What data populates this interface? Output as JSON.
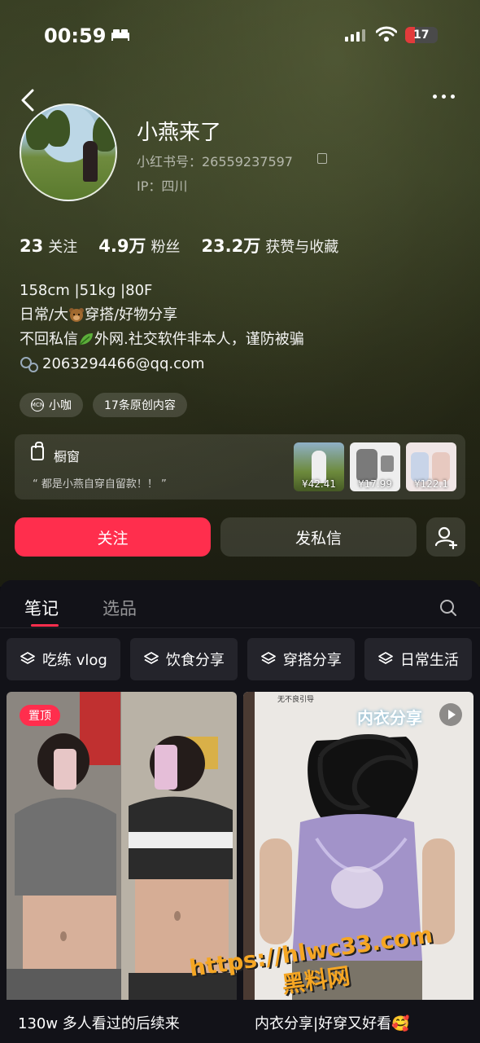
{
  "status_bar": {
    "time": "00:59",
    "battery": "17"
  },
  "profile": {
    "name": "小燕来了",
    "redbook_id": "小红书号：26559237597",
    "ip": "IP：四川"
  },
  "stats": [
    {
      "num": "23",
      "label": "关注"
    },
    {
      "num": "4.9万",
      "label": "粉丝"
    },
    {
      "num": "23.2万",
      "label": "获赞与收藏"
    }
  ],
  "bio": {
    "line1": "158cm |51kg |80F",
    "line2_a": "日常/大",
    "line2_b": "穿搭/好物分享",
    "line3_a": "不回私信",
    "line3_b": "外网.社交软件非本人，谨防被骗",
    "email": "2063294466@qq.com"
  },
  "tags": {
    "mcn": "小咖",
    "mcn_badge": "MCN",
    "original": "17条原创内容"
  },
  "shop": {
    "title": "橱窗",
    "desc": "“ 都是小燕自穿自留款！！ ”",
    "prices": [
      "¥42.41",
      "¥17.99",
      "¥122.1"
    ]
  },
  "actions": {
    "follow": "关注",
    "message": "发私信"
  },
  "tabs": {
    "notes": "笔记",
    "picks": "选品"
  },
  "chips": [
    "吃练 vlog",
    "饮食分享",
    "穿搭分享",
    "日常生活"
  ],
  "cards": [
    {
      "caption": "130w 多人看过的后续来",
      "badge": "置顶"
    },
    {
      "caption": "内衣分享|好穿又好看🥰",
      "overlay": "内衣分享",
      "small_text": "无不良引导"
    }
  ],
  "watermark": {
    "line1": "https://hlwc33.com",
    "line2": "黑料网"
  },
  "colors": {
    "accent": "#ff2e4d",
    "panel": "#121218"
  }
}
